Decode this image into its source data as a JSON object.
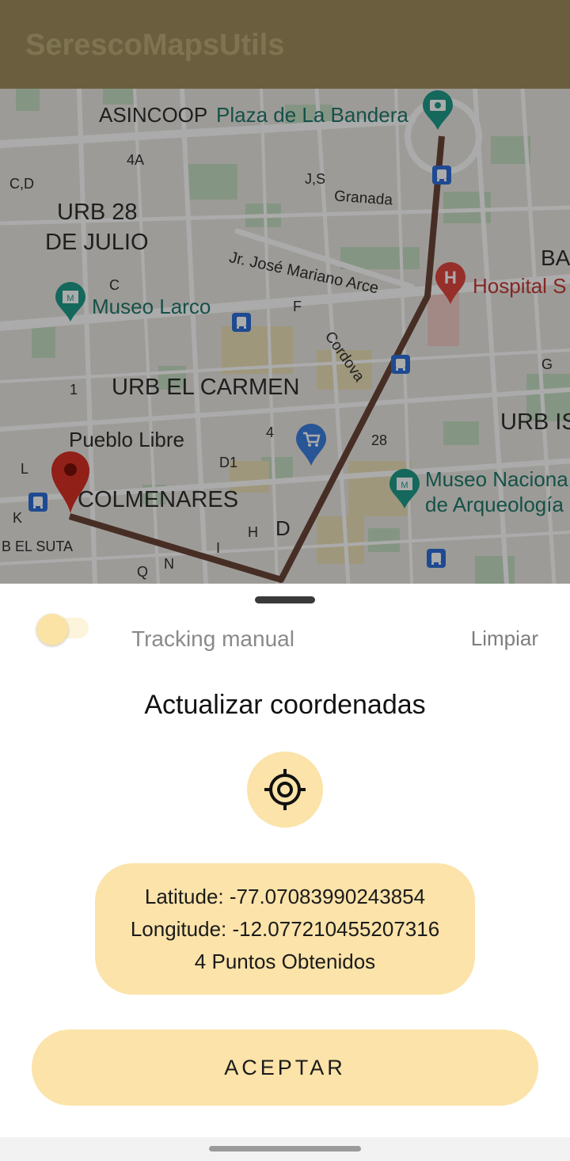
{
  "app_bar": {
    "title": "SerescoMapsUtils"
  },
  "map": {
    "labels": {
      "asincoop": "ASINCOOP",
      "plaza": "Plaza de La Bandera",
      "l4a": "4A",
      "cd": "C,D",
      "js": "J,S",
      "granada": "Granada",
      "urb28_line1": "URB 28",
      "urb28_line2": "DE JULIO",
      "arce": "Jr. José Mariano Arce",
      "ba": "BA",
      "hospital": "Hospital S",
      "c": "C",
      "museo_larco": "Museo Larco",
      "f": "F",
      "cordova": "Cordova",
      "g": "G",
      "one": "1",
      "urb_carmen": "URB EL CARMEN",
      "urb_is": "URB IS",
      "pueblo_libre": "Pueblo Libre",
      "four": "4",
      "twentyeight": "28",
      "l": "L",
      "d1": "D1",
      "museo_nac1": "Museo Naciona",
      "museo_nac2": "de Arqueología",
      "colmenares": "COLMENARES",
      "k": "K",
      "h": "H",
      "d": "D",
      "suta": "B EL SUTA",
      "i": "I",
      "n": "N",
      "q": "Q"
    },
    "icons": [
      "camera-marker-icon",
      "bus-stop-icon",
      "museum-marker-icon",
      "hospital-marker-icon",
      "shopping-cart-marker-icon",
      "location-pin-icon"
    ]
  },
  "sheet": {
    "tracking_toggle": {
      "label": "Tracking manual",
      "on": false
    },
    "clear_label": "Limpiar",
    "update_title": "Actualizar coordenadas",
    "locate_icon": "my-location-icon",
    "coordinates": {
      "latitude": "Latitude: -77.07083990243854",
      "longitude": "Longitude: -12.077210455207316",
      "points": "4 Puntos Obtenidos"
    },
    "accept_label": "ACEPTAR"
  },
  "colors": {
    "app_bar": "#6b5e3e",
    "accent": "#fbe3a9",
    "route": "#5a3c30",
    "pin": "#b3261e"
  }
}
